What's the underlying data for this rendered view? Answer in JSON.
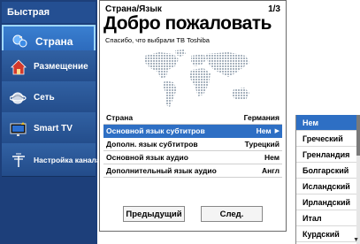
{
  "sidebar": {
    "title": "Быстрая установка",
    "items": [
      {
        "label": "Страна",
        "icon": "country-icon",
        "active": true
      },
      {
        "label": "Размещение",
        "icon": "home-icon",
        "active": false
      },
      {
        "label": "Сеть",
        "icon": "network-icon",
        "active": false
      },
      {
        "label": "Smart TV",
        "icon": "smart-tv-icon",
        "active": false
      },
      {
        "label": "Настройка канала",
        "icon": "antenna-icon",
        "active": false
      }
    ]
  },
  "main": {
    "breadcrumb": "Страна/Язык",
    "page_indicator": "1/3",
    "title": "Добро пожаловать",
    "subtitle": "Спасибо, что выбрали ТВ Toshiba",
    "rows": [
      {
        "label": "Страна",
        "value": "Германия",
        "highlighted": false
      },
      {
        "label": "Основной язык субтитров",
        "value": "Нем",
        "highlighted": true
      },
      {
        "label": "Дополн. язык субтитров",
        "value": "Турецкий",
        "highlighted": false
      },
      {
        "label": "Основной язык аудио",
        "value": "Нем",
        "highlighted": false
      },
      {
        "label": "Дополнительный язык аудио",
        "value": "Англ",
        "highlighted": false
      }
    ],
    "prev_button": "Предыдущий",
    "next_button": "След."
  },
  "dropdown": {
    "options": [
      "Нем",
      "Греческий",
      "Гренландия",
      "Болгарский",
      "Исландский",
      "Ирландский",
      "Итал",
      "Курдский"
    ],
    "selected": "Нем"
  },
  "colors": {
    "sidebar_bg": "#1d3f7a",
    "highlight": "#2e6fc4",
    "active_border": "#9fd8ff"
  }
}
